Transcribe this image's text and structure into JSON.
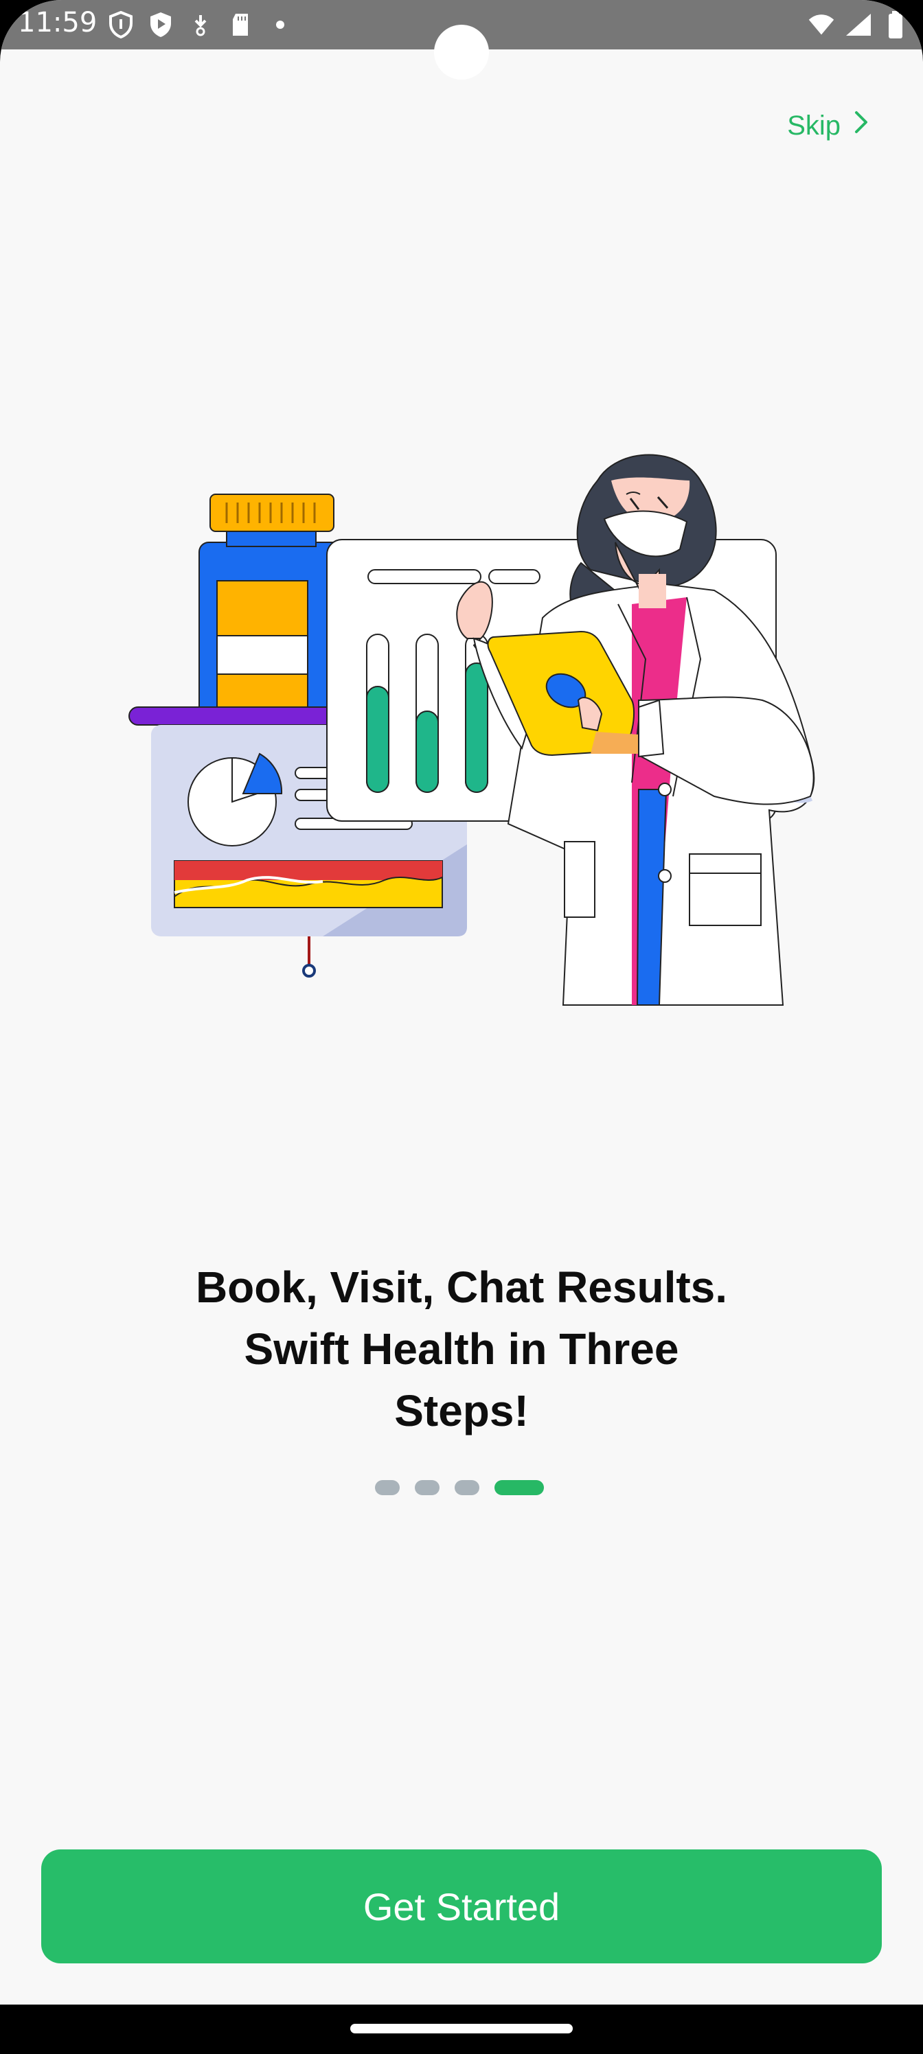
{
  "status_bar": {
    "time": "11:59",
    "left_icons": [
      "shield-icon",
      "play-shield-icon",
      "download-icon",
      "sd-card-icon",
      "dot-icon"
    ],
    "right_icons": [
      "wifi-icon",
      "signal-icon",
      "battery-icon"
    ]
  },
  "header": {
    "skip_label": "Skip"
  },
  "onboarding": {
    "headline_line1": "Book, Visit, Chat Results.",
    "headline_line2": "Swift Health in Three",
    "headline_line3": "Steps!",
    "page_count": 4,
    "active_page": 4
  },
  "cta": {
    "label": "Get Started"
  },
  "colors": {
    "accent": "#27bd69",
    "status_bar": "#777777",
    "background": "#f8f8f8",
    "dot_inactive": "#a9b3ba"
  }
}
